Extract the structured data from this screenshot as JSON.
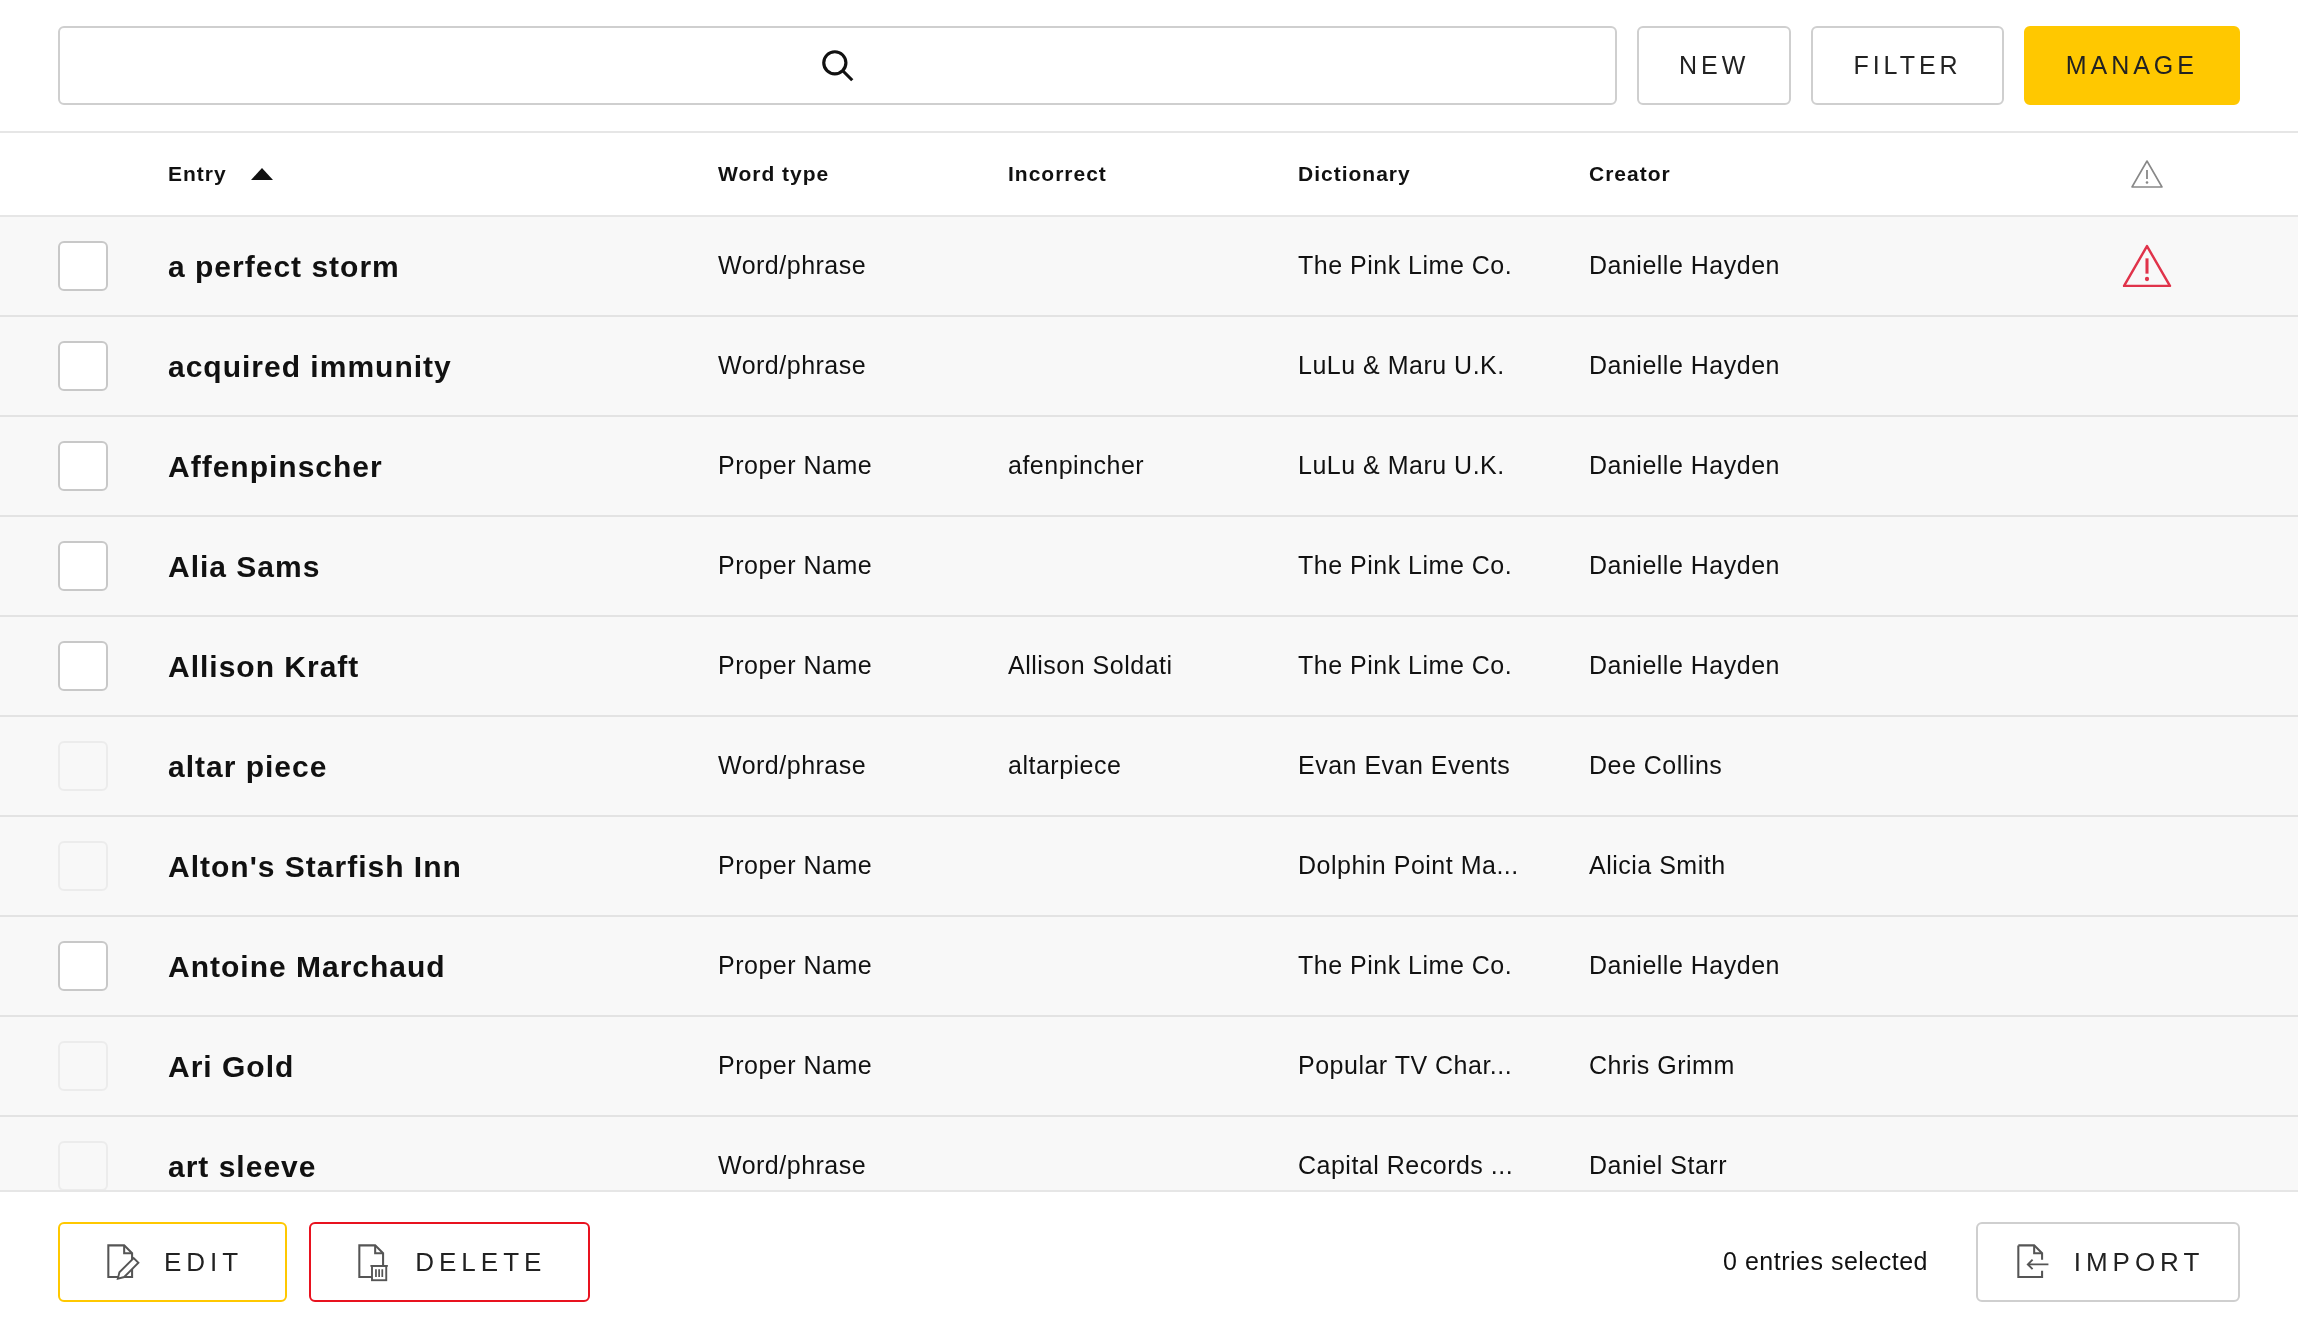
{
  "toolbar": {
    "buttons": [
      {
        "label": "NEW",
        "kind": "plain"
      },
      {
        "label": "FILTER",
        "kind": "plain"
      },
      {
        "label": "MANAGE",
        "kind": "primary"
      }
    ]
  },
  "table": {
    "columns": [
      {
        "label": "Entry",
        "sorted": true
      },
      {
        "label": "Word type",
        "sorted": false
      },
      {
        "label": "Incorrect",
        "sorted": false
      },
      {
        "label": "Dictionary",
        "sorted": false
      },
      {
        "label": "Creator",
        "sorted": false
      }
    ],
    "rows": [
      {
        "checked": false,
        "disabled": false,
        "entry": "a perfect storm",
        "word_type": "Word/phrase",
        "dictionary": "The Pink Lime Co.",
        "creator": "Danielle Hayden",
        "warning": true
      },
      {
        "checked": false,
        "disabled": false,
        "entry": "acquired immunity",
        "word_type": "Word/phrase",
        "dictionary": "LuLu & Maru U.K.",
        "creator": "Danielle Hayden",
        "warning": false
      },
      {
        "checked": false,
        "disabled": false,
        "entry": "Affenpinscher",
        "word_type": "Proper Name",
        "incorrect": "afenpincher",
        "dictionary": "LuLu & Maru U.K.",
        "creator": "Danielle Hayden",
        "warning": false
      },
      {
        "checked": false,
        "disabled": false,
        "entry": "Alia Sams",
        "word_type": "Proper Name",
        "dictionary": "The Pink Lime Co.",
        "creator": "Danielle Hayden",
        "warning": false
      },
      {
        "checked": false,
        "disabled": false,
        "entry": "Allison Kraft",
        "word_type": "Proper Name",
        "incorrect": "Allison Soldati",
        "dictionary": "The Pink Lime Co.",
        "creator": "Danielle Hayden",
        "warning": false
      },
      {
        "checked": false,
        "disabled": true,
        "entry": "altar piece",
        "word_type": "Word/phrase",
        "incorrect": "altarpiece",
        "dictionary": "Evan Evan Events",
        "creator": "Dee Collins",
        "warning": false
      },
      {
        "checked": false,
        "disabled": true,
        "entry": "Alton's Starfish Inn",
        "word_type": "Proper Name",
        "dictionary": "Dolphin Point Ma...",
        "creator": "Alicia Smith",
        "warning": false
      },
      {
        "checked": false,
        "disabled": false,
        "entry": "Antoine Marchaud",
        "word_type": "Proper Name",
        "dictionary": "The Pink Lime Co.",
        "creator": "Danielle Hayden",
        "warning": false
      },
      {
        "checked": false,
        "disabled": true,
        "entry": "Ari Gold",
        "word_type": "Proper Name",
        "dictionary": "Popular TV Char...",
        "creator": "Chris Grimm",
        "warning": false
      },
      {
        "checked": false,
        "disabled": true,
        "entry": "art sleeve",
        "word_type": "Word/phrase",
        "dictionary": "Capital Records ...",
        "creator": "Daniel Starr",
        "warning": false
      }
    ]
  },
  "footer": {
    "buttons": [
      {
        "label": "EDIT",
        "kind": "edit"
      },
      {
        "label": "DELETE",
        "kind": "delete"
      }
    ],
    "selection": "0 entries selected",
    "import": "IMPORT"
  }
}
